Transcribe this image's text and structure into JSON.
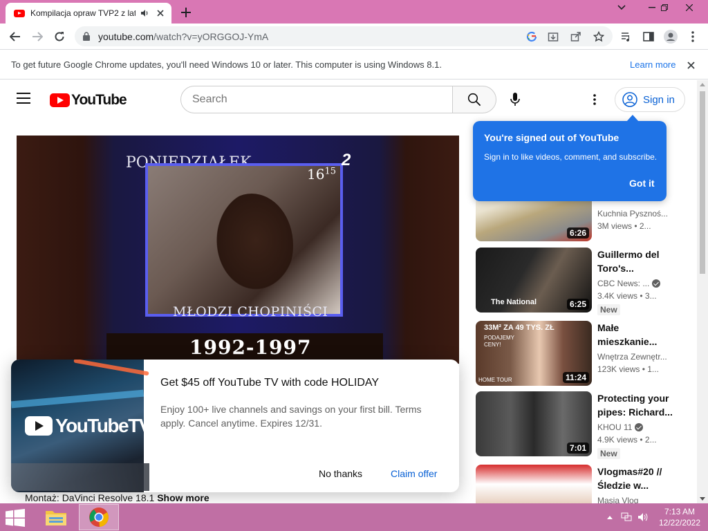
{
  "browser": {
    "tab_title": "Kompilacja opraw TVP2 z lat",
    "url_host": "youtube.com",
    "url_path": "/watch?v=yORGGOJ-YmA"
  },
  "infobar": {
    "message": "To get future Google Chrome updates, you'll need Windows 10 or later. This computer is using Windows 8.1.",
    "link": "Learn more"
  },
  "youtube": {
    "logo_text": "YouTube",
    "search_placeholder": "Search",
    "sign_in": "Sign in"
  },
  "tooltip": {
    "title": "You're signed out of YouTube",
    "body": "Sign in to like videos, comment, and subscribe.",
    "button": "Got it"
  },
  "video": {
    "day_text": "PONIEDZIAŁEK",
    "time_text": "16",
    "time_sup": "15",
    "caption": "MŁODZI CHOPINIŚCI",
    "years": "1992-1997"
  },
  "promo": {
    "art_text": "YouTubeTV",
    "headline": "Get $45 off YouTube TV with code HOLIDAY",
    "body": "Enjoy 100+ live channels and savings on your first bill. Terms apply. Cancel anytime. Expires 12/31.",
    "dismiss": "No thanks",
    "claim": "Claim offer"
  },
  "description": {
    "text": "Montaż: DaVinci Resolve 18.1",
    "more": "Show more"
  },
  "recommendations": [
    {
      "title": "",
      "channel": "Kuchnia Pysznoś...",
      "views": "3M views  • 2...",
      "duration": "6:26",
      "badge": "",
      "verified": false,
      "thumb_text": ""
    },
    {
      "title": "Guillermo del Toro's...",
      "channel": "CBC News: ...",
      "views": "3.4K views  • 3...",
      "duration": "6:25",
      "badge": "New",
      "verified": true,
      "thumb_text": "The National"
    },
    {
      "title": "Małe mieszkanie...",
      "channel": "Wnętrza Zewnętr...",
      "views": "123K views  • 1...",
      "duration": "11:24",
      "badge": "",
      "verified": false,
      "thumb_text": "33M² ZA 49 TYS. ZŁ",
      "thumb_sub": "PODAJEMY CENY!",
      "thumb_tag": "HOME TOUR"
    },
    {
      "title": "Protecting your pipes: Richard...",
      "channel": "KHOU 11",
      "views": "4.9K views  • 2...",
      "duration": "7:01",
      "badge": "New",
      "verified": true,
      "thumb_text": ""
    },
    {
      "title": "Vlogmas#20 // Śledzie w...",
      "channel": "Masia Vlog",
      "views": "",
      "duration": "",
      "badge": "",
      "verified": false,
      "thumb_text": ""
    }
  ],
  "taskbar": {
    "time": "7:13 AM",
    "date": "12/22/2022"
  }
}
